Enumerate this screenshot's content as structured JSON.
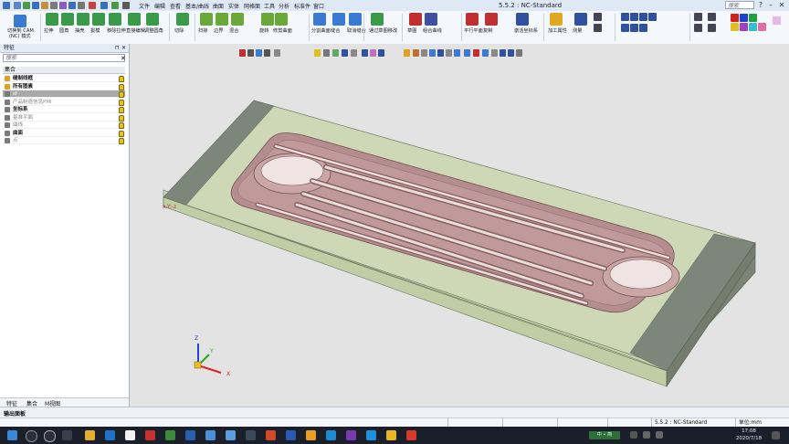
{
  "titlebar": {
    "app_title": "5.5.2 : NC-Standard",
    "search_placeholder": "搜索",
    "menus": [
      "文件",
      "编辑",
      "查看",
      "基本/曲线",
      "曲面",
      "实体",
      "网格面",
      "工具",
      "分析",
      "标准件",
      "窗口"
    ],
    "window_controls": {
      "help": "?",
      "minimize": "–",
      "restore": "❐",
      "close": "✕"
    }
  },
  "ribbon": {
    "cam_button": "切换到 CAM",
    "cam_button_line2": "(NC) 模式",
    "tools": [
      {
        "label": "拉伸",
        "color": "#3a9a4a"
      },
      {
        "label": "圆角",
        "color": "#3a9a4a"
      },
      {
        "label": "抽壳",
        "color": "#3a9a4a"
      },
      {
        "label": "拔模",
        "color": "#3a9a4a"
      },
      {
        "label": "移除拉伸",
        "color": "#3a9a4a"
      },
      {
        "label": "直接编辑",
        "color": "#3a9a4a"
      },
      {
        "label": "调整圆角",
        "color": "#3a9a4a"
      },
      {
        "label": "切除",
        "color": "#3a9a4a"
      },
      {
        "label": "扫掠",
        "color": "#6aa83a"
      },
      {
        "label": "边界",
        "color": "#6aa83a"
      },
      {
        "label": "混合",
        "color": "#6aa83a"
      },
      {
        "label": "旋转",
        "color": "#6aa83a"
      },
      {
        "label": "修剪曲面",
        "color": "#6aa83a"
      },
      {
        "label": "分割曲面",
        "color": "#3a7ad0"
      },
      {
        "label": "缝合",
        "color": "#3a7ad0"
      },
      {
        "label": "取消缝合",
        "color": "#3a7ad0"
      },
      {
        "label": "通过草图移改",
        "color": "#3a9a4a"
      },
      {
        "label": "草图",
        "color": "#c03030"
      },
      {
        "label": "组合曲线",
        "color": "#4050a0"
      },
      {
        "label": "平行平面",
        "color": "#c03030"
      },
      {
        "label": "复制",
        "color": "#c03030"
      },
      {
        "label": "激活坐标系",
        "color": "#3050a0"
      },
      {
        "label": "加工属性",
        "color": "#e0a820"
      },
      {
        "label": "测量",
        "color": "#3050a0"
      }
    ]
  },
  "panel": {
    "title": "特征",
    "search_placeholder": "搜索",
    "header": "集合",
    "rows": [
      {
        "label": "缝制线框",
        "style": "bold"
      },
      {
        "label": "所有图素",
        "style": "bold"
      },
      {
        "label": "sf",
        "style": "sel"
      },
      {
        "label": "产品制造信息PMI",
        "style": "grey"
      },
      {
        "label": "坐标系",
        "style": "bold"
      },
      {
        "label": "基准平面",
        "style": "grey"
      },
      {
        "label": "曲线",
        "style": "grey"
      },
      {
        "label": "曲面",
        "style": "bold"
      },
      {
        "label": "点",
        "style": "grey"
      }
    ],
    "tabs": [
      "特征",
      "集合",
      "M视图"
    ]
  },
  "viewport": {
    "label_near_part": "x-Y:-z",
    "axis_x": "X",
    "axis_y": "Y",
    "axis_z": "Z"
  },
  "output": {
    "label": "输出面板"
  },
  "status": {
    "mode": "5.5.2 : NC-Standard",
    "units": "单位:mm"
  },
  "taskbar": {
    "time": "17:08",
    "date": "2020/7/18",
    "ime": "中 ∙ 简"
  },
  "colors": {
    "block_side": "#c2d0a4",
    "block_top": "#ccd5b3",
    "block_end": "#7b8474",
    "pocket": "#b48e8e",
    "accent": "#1e72c8"
  }
}
